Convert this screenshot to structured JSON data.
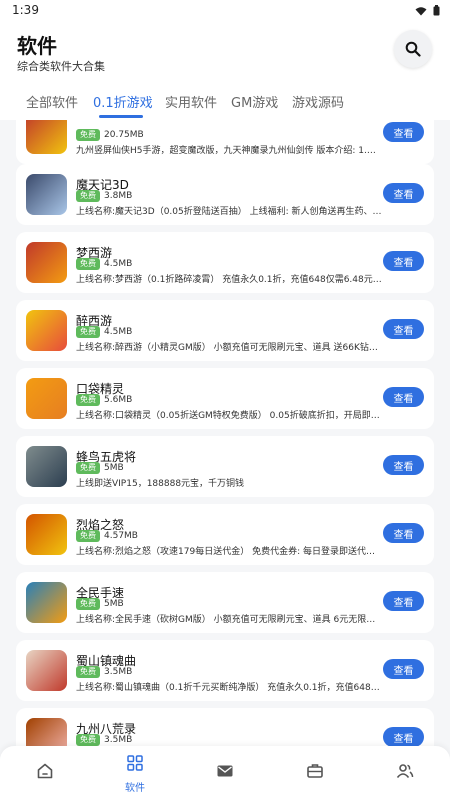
{
  "status_bar": {
    "time": "1:39"
  },
  "header": {
    "title": "软件",
    "subtitle": "综合类软件大合集",
    "tabs": [
      {
        "label": "全部软件"
      },
      {
        "label": "0.1折游戏"
      },
      {
        "label": "实用软件"
      },
      {
        "label": "GM游戏"
      },
      {
        "label": "游戏源码"
      }
    ],
    "active_tab": "0.1折游戏"
  },
  "games": [
    {
      "name": "",
      "badge": "免费",
      "size": "20.75MB",
      "desc": "九州竖屏仙侠H5手游，超变魔改版，九天神魔录九州仙剑传 版本介绍: 1.新增仙帝…",
      "button": "查看",
      "colors": [
        "#c0392b",
        "#f1c40f"
      ]
    },
    {
      "name": "魔天记3D",
      "badge": "免费",
      "size": "3.8MB",
      "desc": "上线名称:魔天记3D（0.05折登陆送百抽） 上线福利: 新人创角送再生药、角色更…",
      "button": "查看",
      "colors": [
        "#3b4a6b",
        "#a9c6e8"
      ]
    },
    {
      "name": "梦西游",
      "badge": "免费",
      "size": "4.5MB",
      "desc": "上线名称:梦西游（0.1折路碎凌霄） 充值永久0.1折，充值648仅需6.48元 上线福…",
      "button": "查看",
      "colors": [
        "#c0392b",
        "#f39c12"
      ]
    },
    {
      "name": "醉西游",
      "badge": "免费",
      "size": "4.5MB",
      "desc": "上线名称:醉西游（小精灵GM版） 小额充值可无限刷元宝、道具 送66K钻石、888…",
      "button": "查看",
      "colors": [
        "#f1c40f",
        "#e74c3c"
      ]
    },
    {
      "name": "口袋精灵",
      "badge": "免费",
      "size": "5.6MB",
      "desc": "上线名称:口袋精灵（0.05折送GM特权免费版） 0.05折破底折扣，开局即送UR超…",
      "button": "查看",
      "colors": [
        "#f39c12",
        "#e67e22"
      ]
    },
    {
      "name": "蜂鸟五虎将",
      "badge": "免费",
      "size": "5MB",
      "desc": "上线即送VIP15，188888元宝，千万铜钱",
      "button": "查看",
      "colors": [
        "#7f8c8d",
        "#2c3e50"
      ]
    },
    {
      "name": "烈焰之怒",
      "badge": "免费",
      "size": "4.57MB",
      "desc": "上线名称:烈焰之怒（攻速179每日送代金） 免费代金券: 每日登录即送代金券，可…",
      "button": "查看",
      "colors": [
        "#d35400",
        "#f1c40f"
      ]
    },
    {
      "name": "全民手速",
      "badge": "免费",
      "size": "5MB",
      "desc": "上线名称:全民手速（砍树GM版） 小额充值可无限刷元宝、道具 6元无限元宝、98…",
      "button": "查看",
      "colors": [
        "#2980b9",
        "#f39c12"
      ]
    },
    {
      "name": "蜀山镇魂曲",
      "badge": "免费",
      "size": "3.5MB",
      "desc": "上线名称:蜀山镇魂曲（0.1折千元买断纯净版） 充值永久0.1折，充值648仅需6.4…",
      "button": "查看",
      "colors": [
        "#e8d5c4",
        "#c0392b"
      ]
    },
    {
      "name": "九州八荒录",
      "badge": "免费",
      "size": "3.5MB",
      "desc": "",
      "button": "查看",
      "colors": [
        "#a04000",
        "#f5b7b1"
      ]
    }
  ],
  "bottom_nav": [
    {
      "icon": "home-icon",
      "label": ""
    },
    {
      "icon": "apps-grid-icon",
      "label": "软件"
    },
    {
      "icon": "mail-icon",
      "label": ""
    },
    {
      "icon": "briefcase-icon",
      "label": ""
    },
    {
      "icon": "users-icon",
      "label": ""
    }
  ],
  "accent_color": "#2f6fe0",
  "badge_color": "#5fba5c"
}
